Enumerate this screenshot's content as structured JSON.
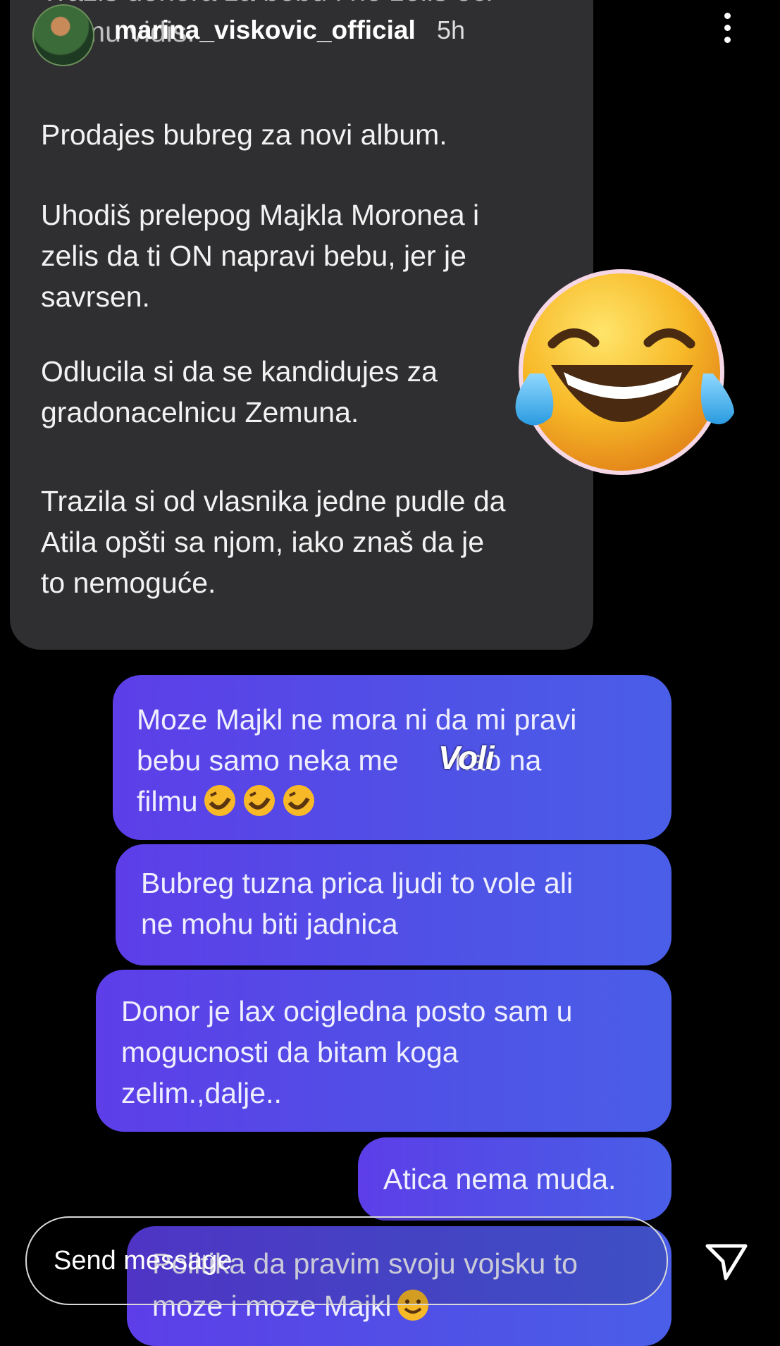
{
  "header": {
    "username": "marina_viskovic_official",
    "time": "5h"
  },
  "received": {
    "cut_top_line": "Trazis donora za bebu i ne zelis oci",
    "cut_second_line": "da mu vidis.",
    "paragraphs": [
      "Prodajes bubreg za novi album.",
      "Uhodiš prelepog Majkla Moronea i\nzelis da ti ON napravi bebu, jer je\nsavrsen.",
      "Odlucila si da se kandidujes za\ngradonacelnicu Zemuna.",
      "Trazila si od vlasnika jedne pudle da\nAtila opšti sa njom, iako znaš da je\nto nemoguće."
    ]
  },
  "sent": [
    {
      "line1": "Moze Majkl ne mora ni da mi pravi",
      "line2": "bebu samo neka me       kao na",
      "line3": "filmu"
    },
    {
      "line1": "Bubreg tuzna prica ljudi to vole ali",
      "line2": "ne mohu biti jadnica"
    },
    {
      "line1": "Donor je lax ocigledna posto sam u",
      "line2": "mogucnosti da bitam koga",
      "line3": "zelim.,dalje.."
    },
    {
      "line1": "Atica nema muda."
    },
    {
      "line1": "Politika da pravim svoju vojsku to",
      "line2": "moze i moze Majkl"
    }
  ],
  "sticker_text": "Voli",
  "reply_bar": {
    "placeholder": "Send message"
  },
  "icons": {
    "menu": "more-vertical-icon",
    "send": "send-paper-plane-icon",
    "sticker": "laughing-tears-emoji"
  },
  "colors": {
    "received_bubble": "#2f2f31",
    "sent_bubble": "#5b45e6",
    "background": "#000000"
  }
}
